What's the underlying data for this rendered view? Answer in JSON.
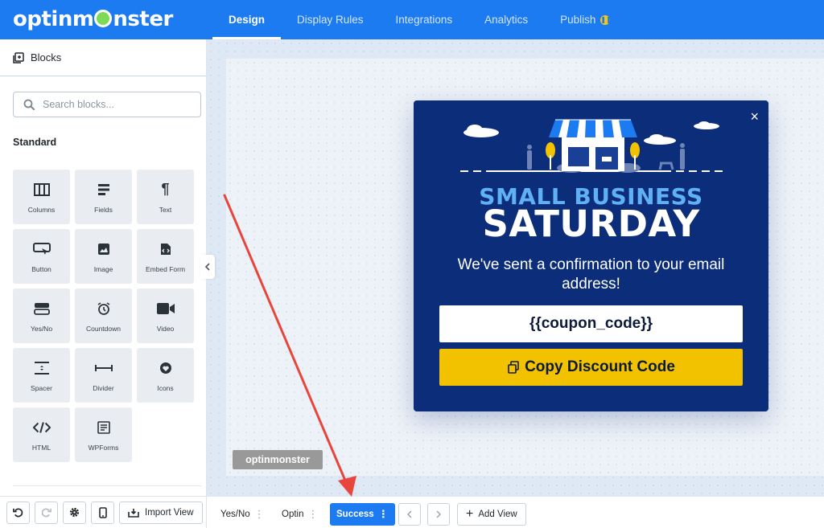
{
  "app": {
    "logo_text_1": "optinm",
    "logo_text_2": "nster"
  },
  "nav": {
    "items": [
      {
        "label": "Design",
        "active": true
      },
      {
        "label": "Display Rules"
      },
      {
        "label": "Integrations"
      },
      {
        "label": "Analytics"
      },
      {
        "label": "Publish"
      }
    ]
  },
  "sidebar": {
    "title": "Blocks",
    "search_placeholder": "Search blocks...",
    "section_title": "Standard",
    "blocks": [
      {
        "label": "Columns",
        "icon": "columns-icon"
      },
      {
        "label": "Fields",
        "icon": "fields-icon"
      },
      {
        "label": "Text",
        "icon": "paragraph-icon"
      },
      {
        "label": "Button",
        "icon": "button-icon"
      },
      {
        "label": "Image",
        "icon": "image-icon"
      },
      {
        "label": "Embed Form",
        "icon": "embed-form-icon"
      },
      {
        "label": "Yes/No",
        "icon": "yes-no-icon"
      },
      {
        "label": "Countdown",
        "icon": "alarm-clock-icon"
      },
      {
        "label": "Video",
        "icon": "video-camera-icon"
      },
      {
        "label": "Spacer",
        "icon": "spacer-icon"
      },
      {
        "label": "Divider",
        "icon": "divider-icon"
      },
      {
        "label": "Icons",
        "icon": "heart-icon"
      },
      {
        "label": "HTML",
        "icon": "code-icon"
      },
      {
        "label": "WPForms",
        "icon": "wpforms-icon"
      }
    ],
    "import_label": "Import View"
  },
  "popup": {
    "title_line1": "SMALL BUSINESS",
    "title_line2": "SATURDAY",
    "message": "We've sent a confirmation to your email address!",
    "coupon_field": "{{coupon_code}}",
    "copy_button": "Copy Discount Code",
    "close": "×"
  },
  "watermark": {
    "text": "optinmonster"
  },
  "views": {
    "tabs": [
      {
        "label": "Yes/No"
      },
      {
        "label": "Optin"
      },
      {
        "label": "Success",
        "active": true
      }
    ],
    "add_label": "Add View",
    "dots": "⋮"
  },
  "colors": {
    "brand_blue": "#1d7bf2",
    "popup_bg": "#0c2d7a",
    "title_light_blue": "#5fb0f5",
    "button_yellow": "#f2c200",
    "annotation_red": "#e8453c"
  }
}
